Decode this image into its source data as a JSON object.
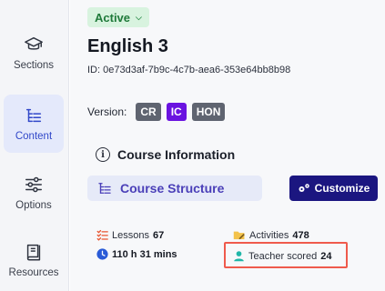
{
  "sidebar": {
    "items": [
      {
        "label": "Sections",
        "icon": "graduation-cap-icon"
      },
      {
        "label": "Content",
        "icon": "content-tree-icon",
        "active": true
      },
      {
        "label": "Options",
        "icon": "sliders-icon"
      },
      {
        "label": "Resources",
        "icon": "book-icon"
      }
    ]
  },
  "header": {
    "status": "Active",
    "title": "English 3",
    "course_id": "ID: 0e73d3af-7b9c-4c7b-aea6-353e64bb8b98"
  },
  "version": {
    "label": "Version:",
    "badges": [
      "CR",
      "IC",
      "HON"
    ],
    "selected": "IC"
  },
  "course_info": {
    "title": "Course Information",
    "structure_label": "Course Structure",
    "customize_label": "Customize"
  },
  "stats": {
    "lessons_label": "Lessons",
    "lessons_value": "67",
    "activities_label": "Activities",
    "activities_value": "478",
    "duration": "110 h 31 mins",
    "teacher_label": "Teacher scored",
    "teacher_value": "24"
  },
  "colors": {
    "accent": "#3148c9",
    "active_status": "#1f7a3a",
    "primary_button": "#1b1680",
    "highlight": "#ef5a4c"
  }
}
